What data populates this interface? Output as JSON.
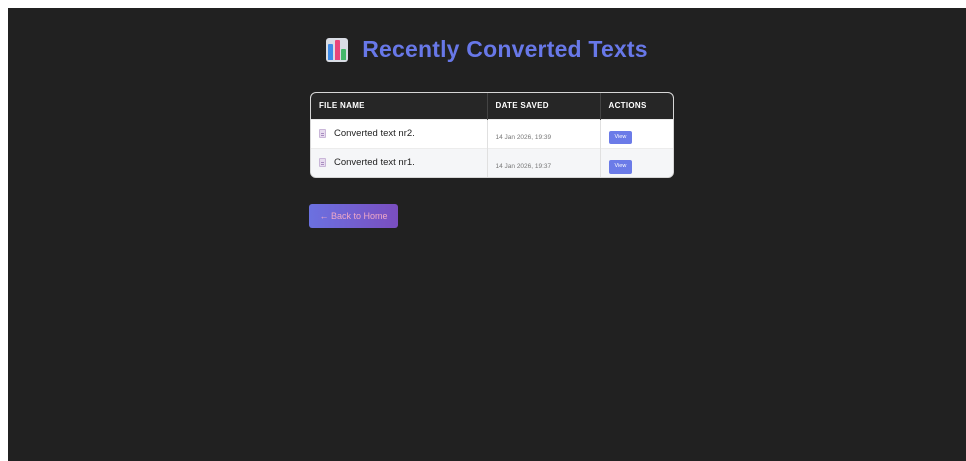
{
  "header": {
    "icon": "bar-chart-icon",
    "title": "Recently Converted Texts"
  },
  "table": {
    "columns": [
      "FILE NAME",
      "DATE SAVED",
      "ACTIONS"
    ],
    "rows": [
      {
        "file_name": "Converted text nr2.",
        "date_saved": "14 Jan 2026, 19:39",
        "action_label": "View",
        "icon": "document-icon"
      },
      {
        "file_name": "Converted text nr1.",
        "date_saved": "14 Jan 2026, 19:37",
        "action_label": "View",
        "icon": "document-icon"
      }
    ]
  },
  "nav": {
    "back_label": "← Back to Home"
  },
  "colors": {
    "background": "#212121",
    "accent": "#6878e8",
    "table_header": "#262626"
  }
}
